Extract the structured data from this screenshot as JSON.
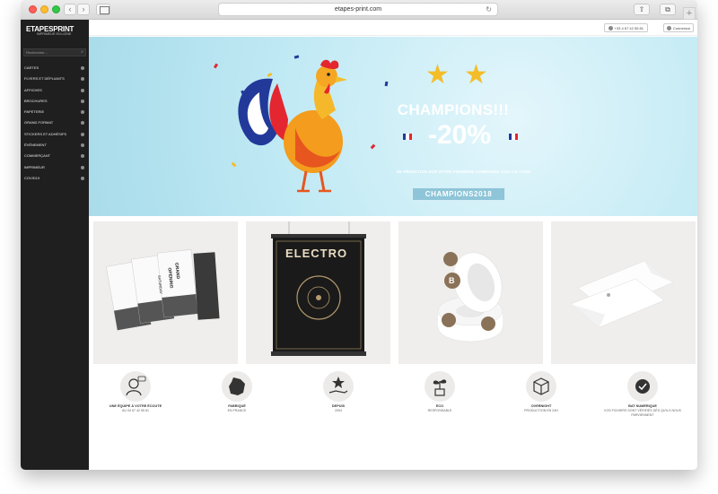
{
  "browser": {
    "url": "etapes-print.com",
    "back": "‹",
    "forward": "›",
    "reload": "↻",
    "share": "⇧",
    "tabs": "⧉",
    "new_tab": "+"
  },
  "sidebar": {
    "logo_main": "ETAPESPRINT",
    "logo_sub": "IMPRIMEUR EN LIGNE",
    "search_placeholder": "Rechercher...",
    "items": [
      {
        "label": "CARTES"
      },
      {
        "label": "FLYERS ET DÉPLIANTS"
      },
      {
        "label": "AFFICHES"
      },
      {
        "label": "BROCHURES"
      },
      {
        "label": "PAPETERIE"
      },
      {
        "label": "GRAND FORMAT"
      },
      {
        "label": "STICKERS ET ADHÉSIFS"
      },
      {
        "label": "ÉVÉNEMENT"
      },
      {
        "label": "COMMERÇANT"
      },
      {
        "label": "IMPRIMEUR"
      },
      {
        "label": "COVID19"
      }
    ]
  },
  "topbar": {
    "phone": "+33 4 67 42 55 81",
    "login": "Connexion"
  },
  "banner": {
    "headline": "CHAMPIONS!!!",
    "discount": "-20%",
    "tagline": "DE RÉDUCTION SUR VOTRE PREMIÈRE COMMANDE AVEC LE CODE",
    "code": "CHAMPIONS2018",
    "colors": {
      "sky": "#bfe9f4",
      "star": "#f3bd2a",
      "flag_blue": "#22399a",
      "flag_red": "#e3262f"
    }
  },
  "products": [
    {
      "name": "flyers",
      "texts": [
        "GRAND",
        "OPENING",
        "SATURDAY"
      ]
    },
    {
      "name": "affiche",
      "texts": [
        "ELECTRO"
      ]
    },
    {
      "name": "stickers",
      "texts": [
        "B"
      ]
    },
    {
      "name": "enveloppes",
      "texts": []
    }
  ],
  "features": [
    {
      "icon": "support-icon",
      "title": "UNE ÉQUIPE À VOTRE ÉCOUTE",
      "sub": "AU 04 67 42 55 81"
    },
    {
      "icon": "france-map-icon",
      "title": "FABRIQUÉ",
      "sub": "EN FRANCE"
    },
    {
      "icon": "hand-star-icon",
      "title": "DEPUIS",
      "sub": "2004"
    },
    {
      "icon": "plant-icon",
      "title": "ECO",
      "sub": "RESPONSABLE"
    },
    {
      "icon": "box-icon",
      "title": "OVERNIGHT",
      "sub": "PRODUCTION EN 24H"
    },
    {
      "icon": "check-icon",
      "title": "BAT NUMÉRIQUE",
      "sub": "VOS FICHIERS SONT VÉRIFIÉS DÈS QU'ILS NOUS PARVIENNENT"
    }
  ]
}
